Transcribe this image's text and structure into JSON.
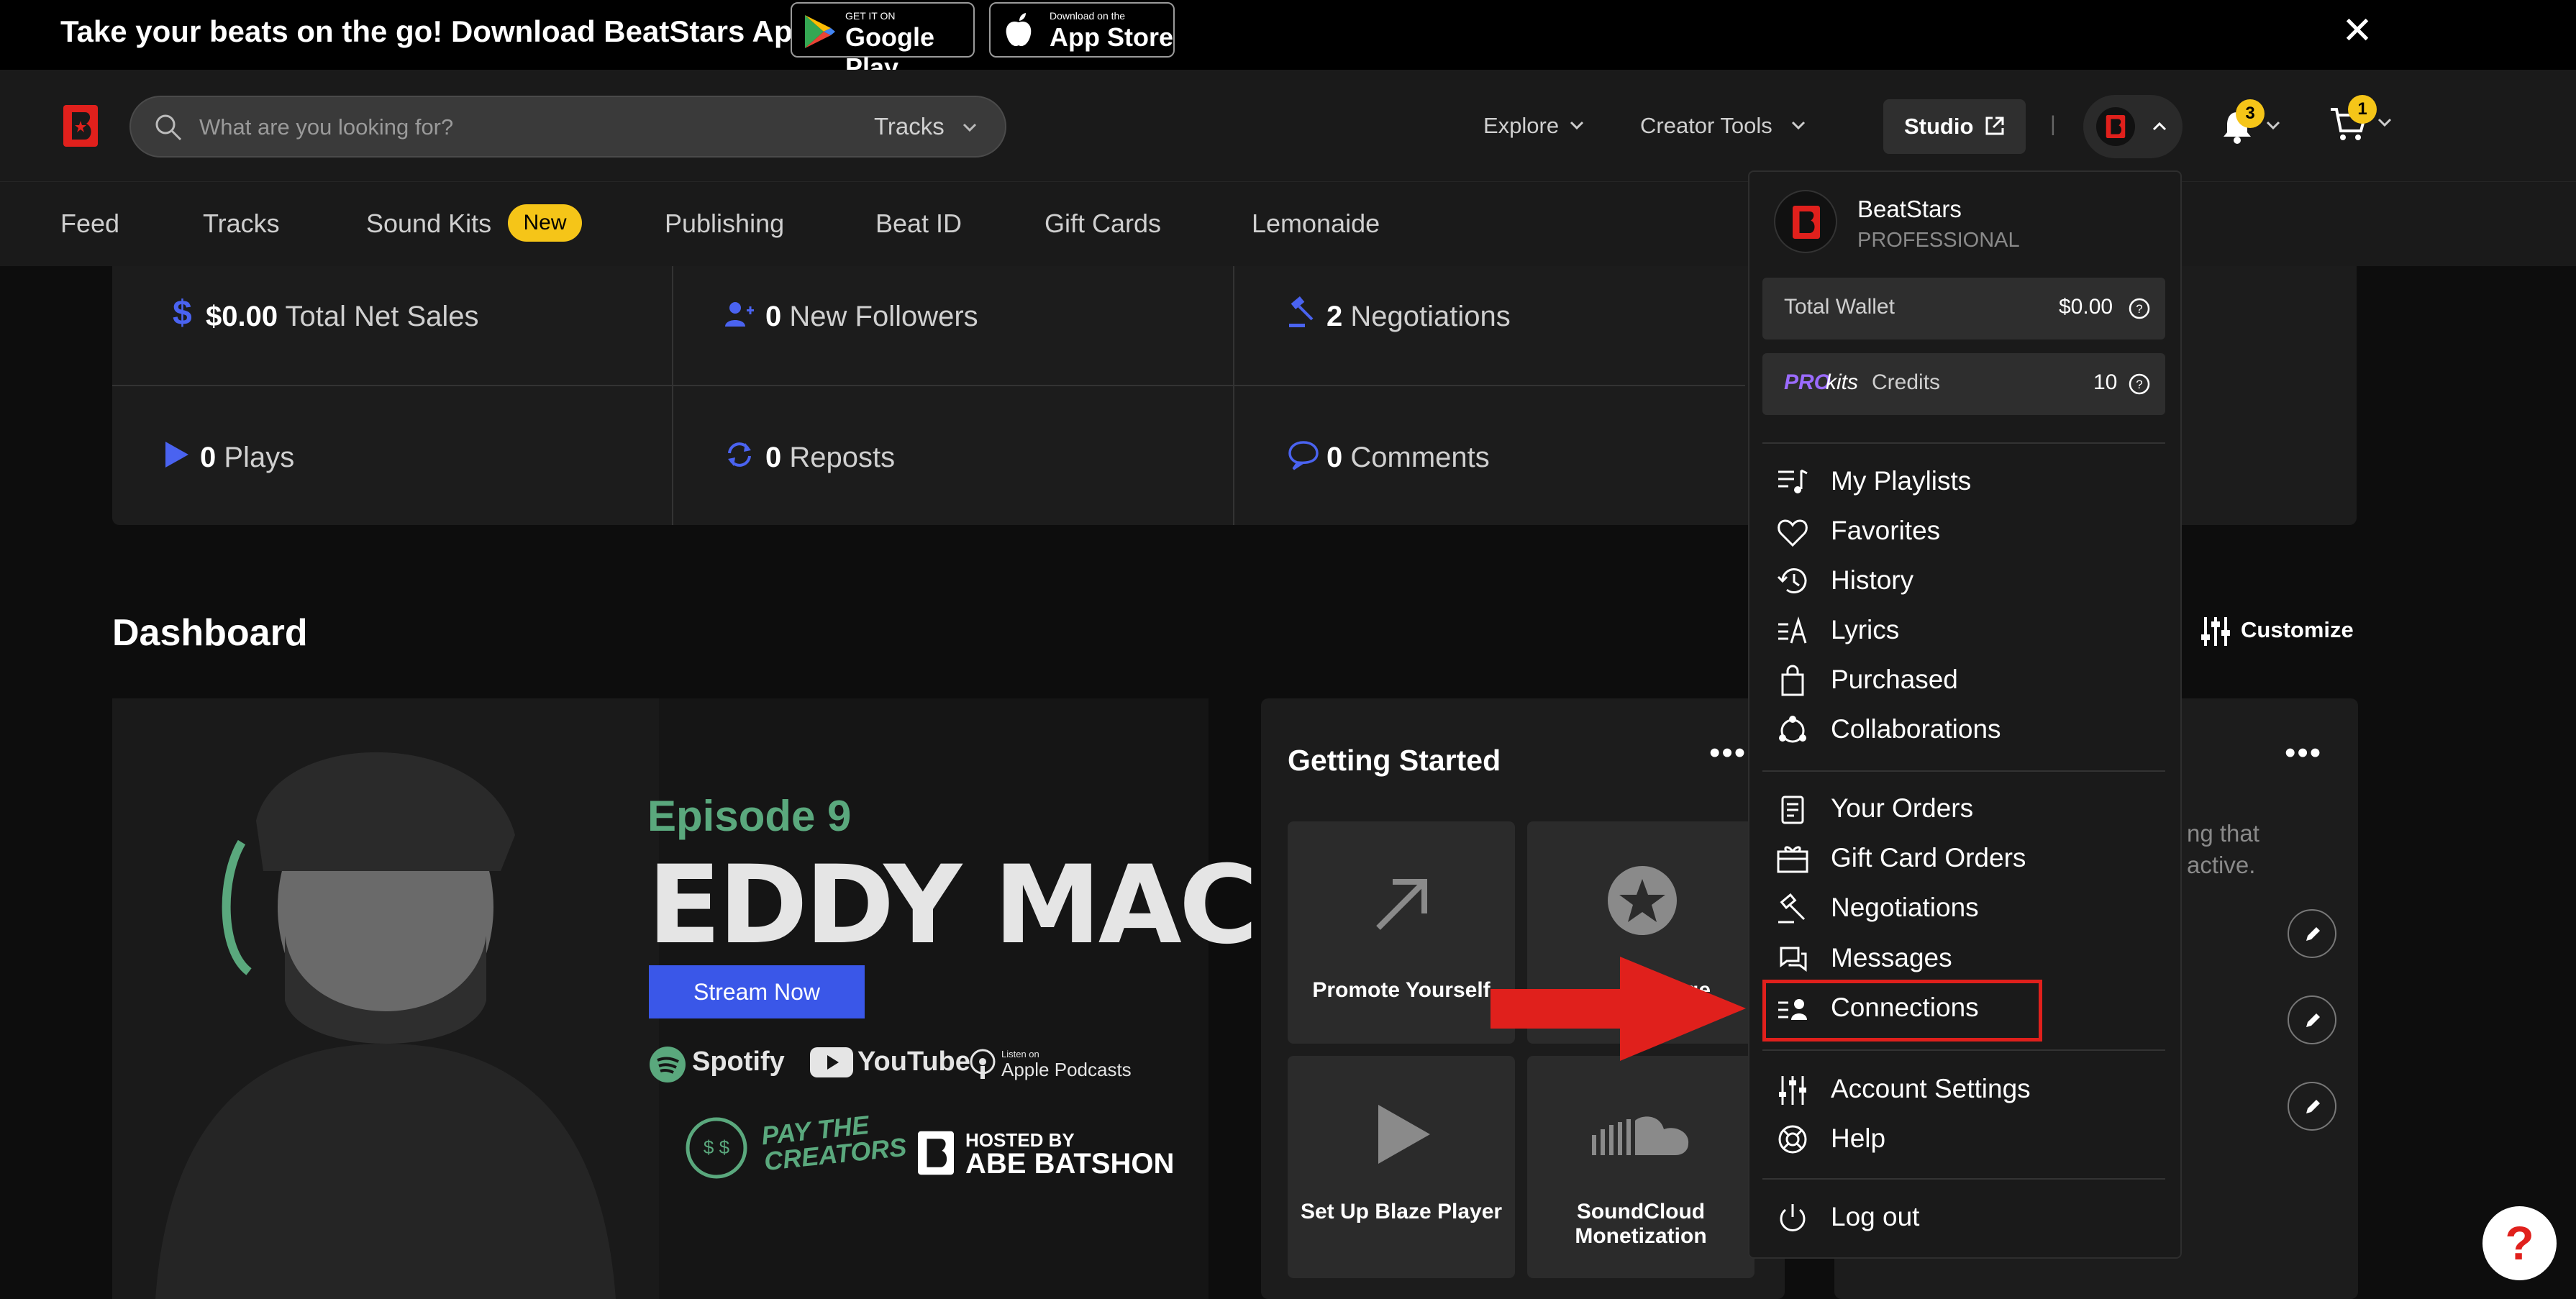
{
  "promo": {
    "text": "Take your beats on the go! Download BeatStars App",
    "google_small": "GET IT ON",
    "google_big": "Google Play",
    "apple_small": "Download on the",
    "apple_big": "App Store"
  },
  "header": {
    "search_placeholder": "What are you looking for?",
    "search_scope": "Tracks",
    "explore": "Explore",
    "creator_tools": "Creator Tools",
    "studio": "Studio",
    "divider": "|",
    "notifications_count": "3",
    "cart_count": "1"
  },
  "subnav": {
    "items": [
      "Feed",
      "Tracks",
      "Sound Kits",
      "Publishing",
      "Beat ID",
      "Gift Cards",
      "Lemonaide"
    ],
    "new_badge": "New"
  },
  "stats": {
    "net_sales_value": "$0.00",
    "net_sales_label": "Total Net Sales",
    "followers_value": "0",
    "followers_label": "New Followers",
    "negotiations_value": "2",
    "negotiations_label": "Negotiations",
    "plays_value": "0",
    "plays_label": "Plays",
    "reposts_value": "0",
    "reposts_label": "Reposts",
    "comments_value": "0",
    "comments_label": "Comments"
  },
  "dashboard": {
    "title": "Dashboard",
    "customize": "Customize"
  },
  "podcast": {
    "episode": "Episode 9",
    "guest": "EDDY MACK",
    "stream_now": "Stream Now",
    "spotify": "Spotify",
    "youtube": "YouTube",
    "apple_small": "Listen on",
    "apple": "Apple Podcasts",
    "pay_creators": "PAY THE CREATORS",
    "hosted_by": "HOSTED BY",
    "host": "ABE BATSHON"
  },
  "getting_started": {
    "title": "Getting Started",
    "tiles": [
      "Promote Yourself",
      "ge",
      "Set Up Blaze Player",
      "SoundCloud Monetization"
    ]
  },
  "right_card": {
    "text_line1": "ng that",
    "text_line2": "active."
  },
  "dropdown": {
    "name": "BeatStars",
    "plan": "PROFESSIONAL",
    "wallet_label": "Total Wallet",
    "wallet_value": "$0.00",
    "prokits_pro": "PRO",
    "prokits_kits": "kits",
    "credits_label": "Credits",
    "credits_value": "10",
    "menu1": [
      "My Playlists",
      "Favorites",
      "History",
      "Lyrics",
      "Purchased",
      "Collaborations"
    ],
    "menu2": [
      "Your Orders",
      "Gift Card Orders",
      "Negotiations",
      "Messages",
      "Connections"
    ],
    "menu3": [
      "Account Settings",
      "Help"
    ],
    "logout": "Log out"
  },
  "help_button": "?",
  "colors": {
    "accent_red": "#e0201c",
    "badge_yellow": "#f5c518",
    "stream_blue": "#3a57e8",
    "stat_blue": "#4a63f0"
  }
}
